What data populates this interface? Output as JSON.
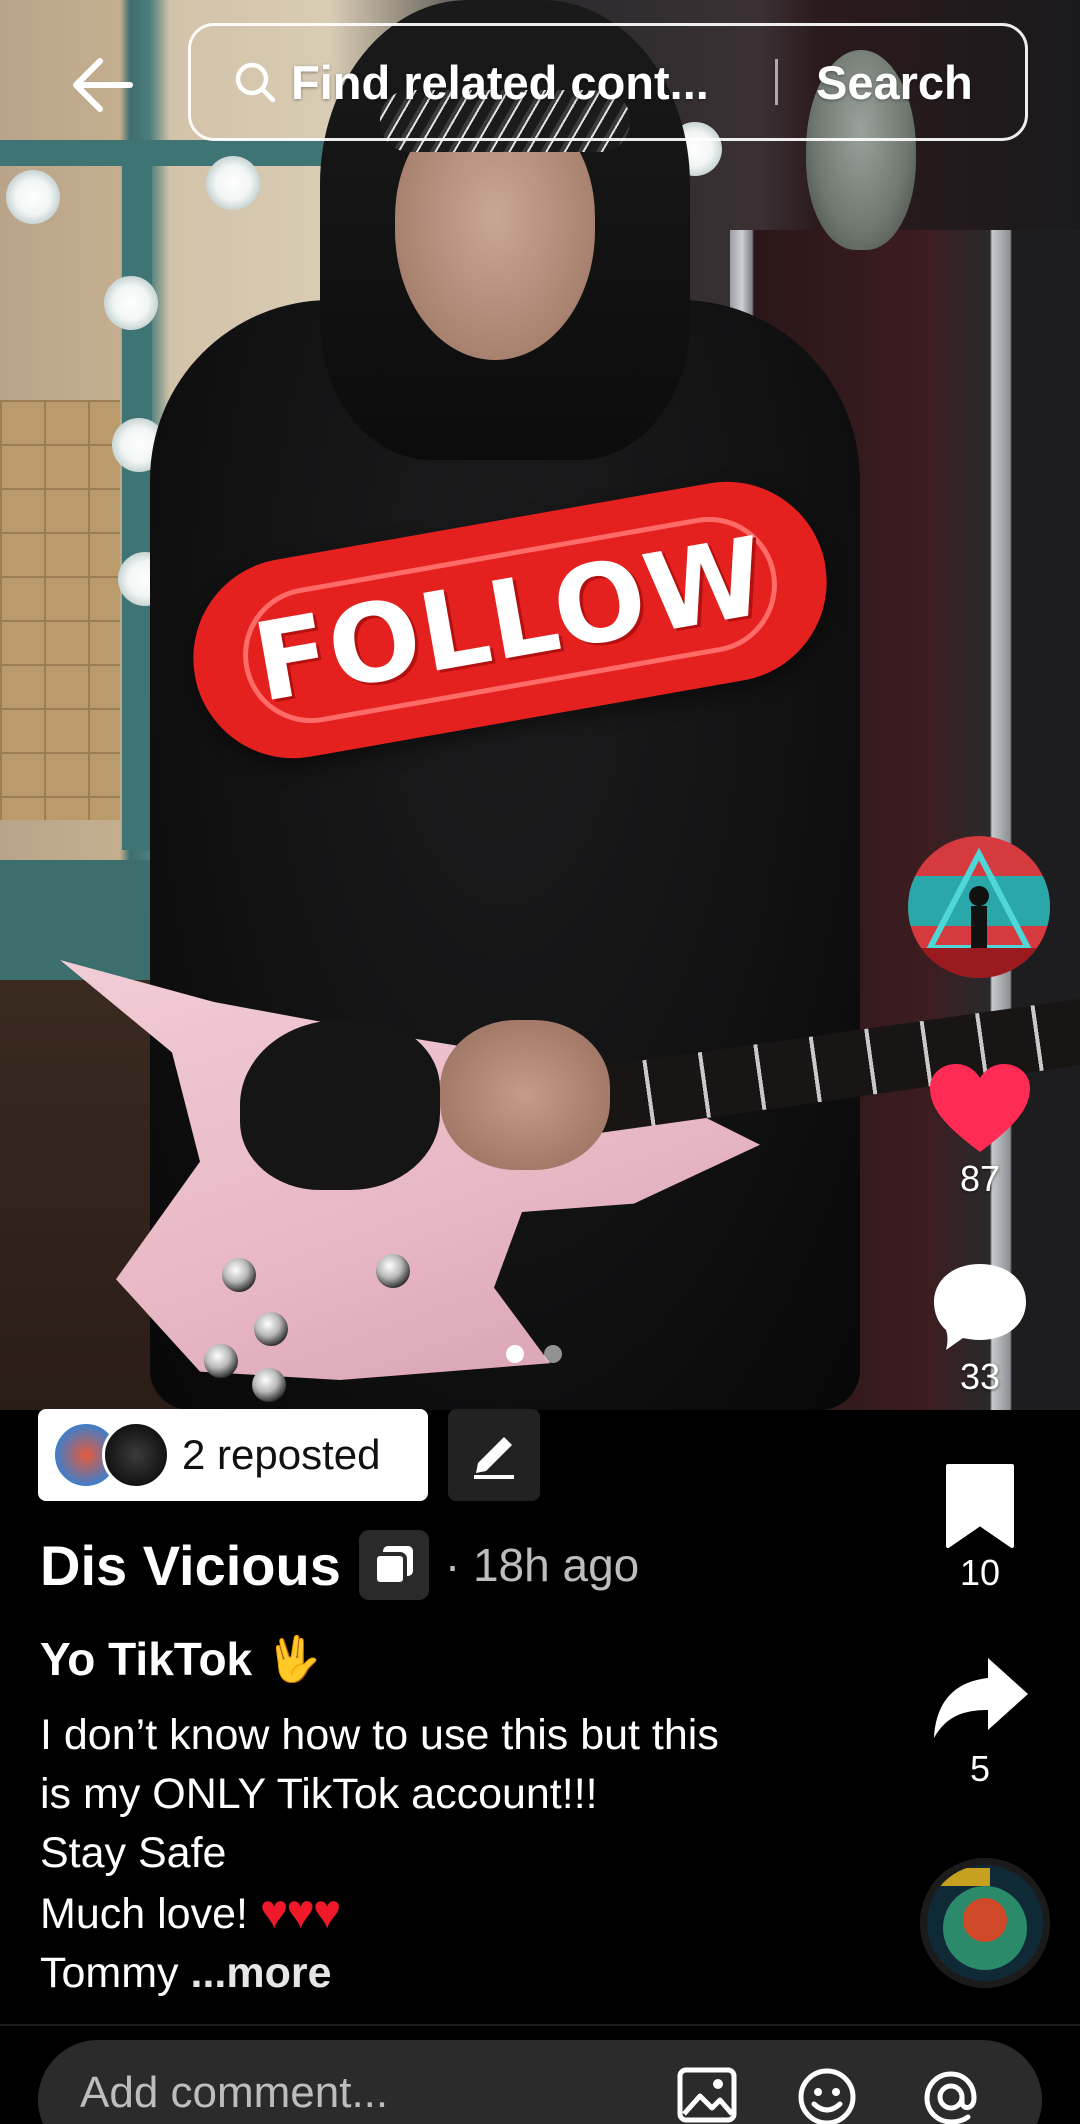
{
  "top_bar": {
    "search_placeholder": "Find related cont...",
    "search_button": "Search"
  },
  "post_media": {
    "sticker_text": "FOLLOW",
    "carousel_pages": 2,
    "carousel_active_index": 0
  },
  "rail": {
    "like_count": "87",
    "comment_count": "33",
    "save_count": "10",
    "share_count": "5",
    "like_color": "#fe2c55"
  },
  "repost": {
    "label": "2 reposted"
  },
  "author": {
    "name": "Dis Vicious",
    "time": "· 18h ago"
  },
  "caption": {
    "title": "Yo TikTok",
    "title_emoji": "🖖",
    "line1": "I don’t know how to use this but this",
    "line2": "is my ONLY TikTok account!!!",
    "line3": "Stay Safe",
    "line4": "Much love!",
    "line4_hearts": "♥♥♥",
    "line5": "Tommy",
    "more": "...more"
  },
  "comment_bar": {
    "placeholder": "Add comment..."
  }
}
